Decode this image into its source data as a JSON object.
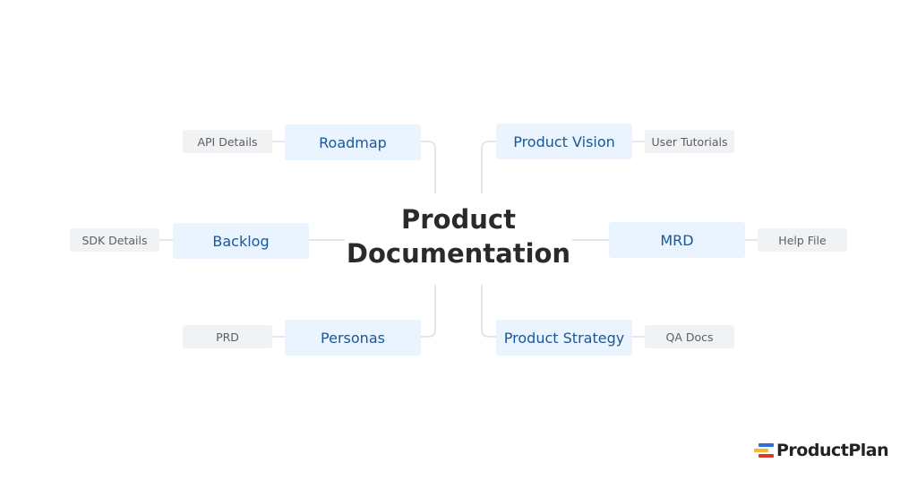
{
  "diagram": {
    "type": "mind-map",
    "center": {
      "line1": "Product",
      "line2": "Documentation"
    },
    "branches": [
      {
        "label": "Roadmap",
        "child": "API Details",
        "side": "left",
        "position": "top"
      },
      {
        "label": "Backlog",
        "child": "SDK Details",
        "side": "left",
        "position": "middle"
      },
      {
        "label": "Personas",
        "child": "PRD",
        "side": "left",
        "position": "bottom"
      },
      {
        "label": "Product Vision",
        "child": "User Tutorials",
        "side": "right",
        "position": "top"
      },
      {
        "label": "MRD",
        "child": "Help File",
        "side": "right",
        "position": "middle"
      },
      {
        "label": "Product Strategy",
        "child": "QA Docs",
        "side": "right",
        "position": "bottom"
      }
    ],
    "colors": {
      "primary_bg": "#e9f4fe",
      "primary_text": "#1b5796",
      "secondary_bg": "#f0f2f4",
      "secondary_text": "#5a5f66",
      "connector": "#dcdfe3"
    }
  },
  "brand": {
    "name": "ProductPlan",
    "logo_colors": [
      "#2f6fd0",
      "#f2b733",
      "#d53a2c"
    ]
  }
}
